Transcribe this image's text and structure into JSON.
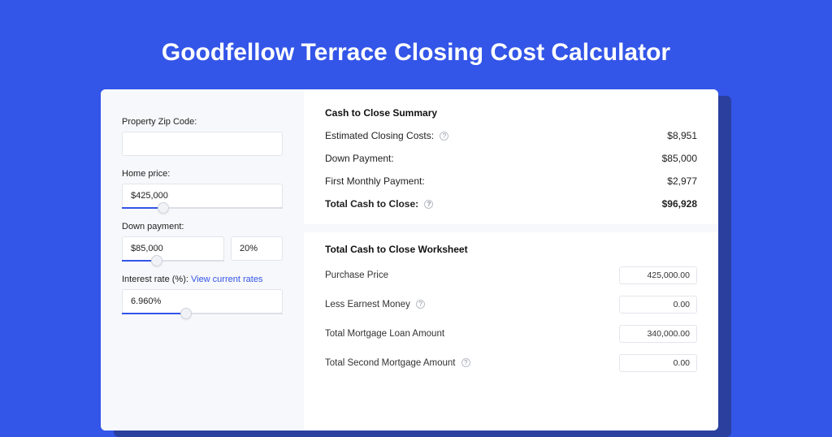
{
  "header": {
    "title": "Goodfellow Terrace Closing Cost Calculator"
  },
  "left": {
    "zip_label": "Property Zip Code:",
    "zip_value": "",
    "home_price_label": "Home price:",
    "home_price_value": "$425,000",
    "home_price_fill_pct": 26,
    "down_payment_label": "Down payment:",
    "down_payment_value": "$85,000",
    "down_payment_pct": "20%",
    "down_payment_fill_pct": 34,
    "interest_label_prefix": "Interest rate (%): ",
    "interest_link": "View current rates",
    "interest_value": "6.960%",
    "interest_fill_pct": 40
  },
  "summary": {
    "title": "Cash to Close Summary",
    "rows": [
      {
        "label": "Estimated Closing Costs:",
        "help": true,
        "value": "$8,951"
      },
      {
        "label": "Down Payment:",
        "help": false,
        "value": "$85,000"
      },
      {
        "label": "First Monthly Payment:",
        "help": false,
        "value": "$2,977"
      }
    ],
    "total_label": "Total Cash to Close:",
    "total_value": "$96,928"
  },
  "worksheet": {
    "title": "Total Cash to Close Worksheet",
    "rows": [
      {
        "label": "Purchase Price",
        "help": false,
        "value": "425,000.00"
      },
      {
        "label": "Less Earnest Money",
        "help": true,
        "value": "0.00"
      },
      {
        "label": "Total Mortgage Loan Amount",
        "help": false,
        "value": "340,000.00"
      },
      {
        "label": "Total Second Mortgage Amount",
        "help": true,
        "value": "0.00"
      }
    ]
  }
}
